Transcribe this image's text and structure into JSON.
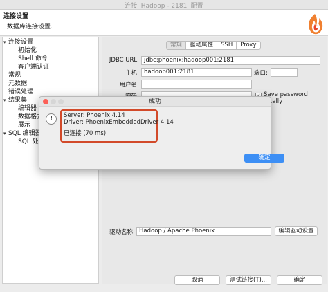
{
  "window": {
    "title": "连接 'Hadoop - 2181' 配置"
  },
  "header": {
    "title": "连接设置",
    "subtitle": "数据库连接设置."
  },
  "sidebar": {
    "items": [
      {
        "label": "连接设置",
        "level": 0,
        "twisty": "▾"
      },
      {
        "label": "初始化",
        "level": 1,
        "twisty": ""
      },
      {
        "label": "Shell 命令",
        "level": 1,
        "twisty": ""
      },
      {
        "label": "客户端认证",
        "level": 1,
        "twisty": ""
      },
      {
        "label": "常规",
        "level": 0,
        "twisty": ""
      },
      {
        "label": "元数据",
        "level": 0,
        "twisty": ""
      },
      {
        "label": "错误处理",
        "level": 0,
        "twisty": ""
      },
      {
        "label": "结果集",
        "level": 0,
        "twisty": "▾"
      },
      {
        "label": "编辑器",
        "level": 1,
        "twisty": ""
      },
      {
        "label": "数据格式化",
        "level": 1,
        "twisty": ""
      },
      {
        "label": "展示",
        "level": 1,
        "twisty": ""
      },
      {
        "label": "SQL 编辑器",
        "level": 0,
        "twisty": "▾"
      },
      {
        "label": "SQL 处理",
        "level": 1,
        "twisty": ""
      }
    ]
  },
  "tabs": [
    "常规",
    "驱动属性",
    "SSH",
    "Proxy"
  ],
  "form": {
    "jdbc_label": "JDBC URL:",
    "jdbc_value": "jdbc:phoenix:hadoop001:2181",
    "host_label": "主机:",
    "host_value": "hadoop001:2181",
    "port_label": "端口:",
    "port_value": "",
    "user_label": "用户名:",
    "user_value": "",
    "password_label": "密码:",
    "password_value": "",
    "save_password_label": "Save password locally",
    "driver_label": "驱动名称:",
    "driver_value": "Hadoop / Apache Phoenix",
    "edit_driver_button": "编辑驱动设置"
  },
  "footer": {
    "cancel": "取消",
    "test": "测试链接(T)...",
    "ok": "确定"
  },
  "dialog": {
    "title": "成功",
    "icon": "!",
    "line1": "Server: Phoenix 4.14",
    "line2": "Driver: PhoenixEmbeddedDriver 4.14",
    "line3": "已连接 (70 ms)",
    "ok": "确定"
  },
  "colors": {
    "accent": "#3d8ff5",
    "highlight": "#d24a2a",
    "close": "#fc5f57"
  }
}
